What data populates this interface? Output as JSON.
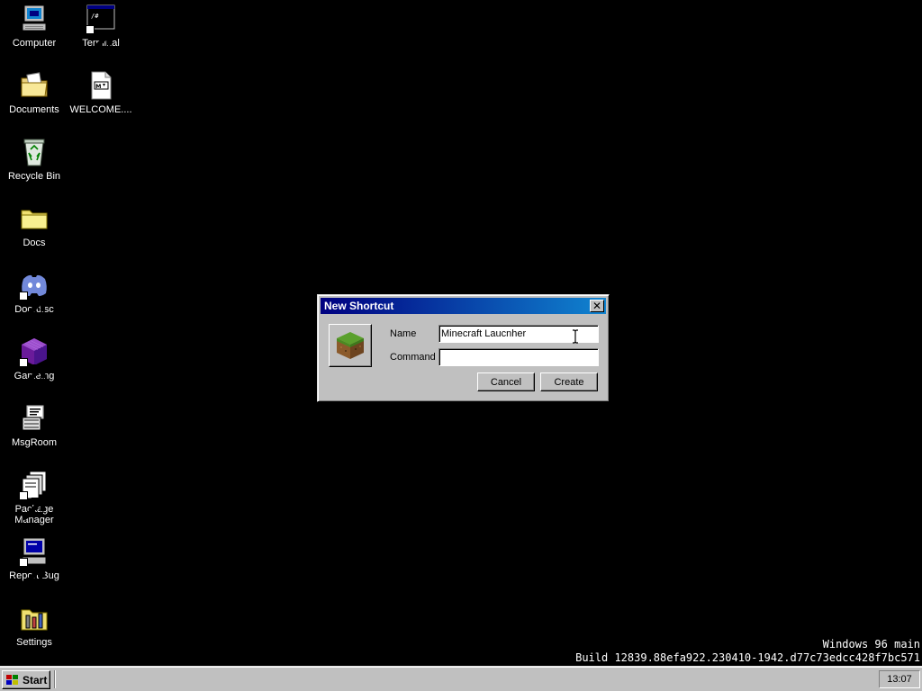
{
  "desktop": {
    "icons": [
      {
        "label": "Computer",
        "icon": "computer-icon"
      },
      {
        "label": "Terminal",
        "icon": "terminal-icon"
      },
      {
        "label": "Documents",
        "icon": "documents-folder-icon"
      },
      {
        "label": "WELCOME....",
        "icon": "markdown-file-icon"
      },
      {
        "label": "Recycle Bin",
        "icon": "recycle-bin-icon"
      },
      {
        "label": "Docs",
        "icon": "folder-icon"
      },
      {
        "label": "Doordisc",
        "icon": "discord-icon"
      },
      {
        "label": "Gameing",
        "icon": "purple-cube-icon"
      },
      {
        "label": "MsgRoom",
        "icon": "msgroom-icon"
      },
      {
        "label": "Package\nManager",
        "icon": "package-manager-icon"
      },
      {
        "label": "Report Bug",
        "icon": "report-bug-icon"
      },
      {
        "label": "Settings",
        "icon": "settings-icon"
      }
    ]
  },
  "build_info": {
    "line1": "Windows 96 main",
    "line2": "Build 12839.88efa922.230410-1942.d77c73edcc428f7bc571"
  },
  "dialog": {
    "title": "New Shortcut",
    "close_icon": "close-icon",
    "shortcut_icon": "minecraft-grass-block-icon",
    "name_label": "Name",
    "name_value": "Minecraft Laucnher",
    "command_label": "Command",
    "command_value": "",
    "cancel_label": "Cancel",
    "create_label": "Create"
  },
  "taskbar": {
    "start_label": "Start",
    "clock": "13:07"
  },
  "colors": {
    "desktop_bg": "#000000",
    "titlebar_start": "#000080",
    "titlebar_end": "#1084d0",
    "chrome": "#c0c0c0"
  }
}
